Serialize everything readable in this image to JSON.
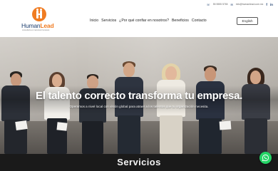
{
  "brand": {
    "name_part1": "Human",
    "name_part2": "Lead",
    "tagline": "consultoría en recursos humanos"
  },
  "contact": {
    "phone": "55 5555 5765",
    "email": "info@humanlead.com.mx",
    "social": [
      "f",
      "in"
    ]
  },
  "nav": {
    "items": [
      "Inicio",
      "Servicios",
      "¿Por qué confiar en nosotros?",
      "Beneficios",
      "Contacto"
    ]
  },
  "language_button": "English",
  "hero": {
    "title": "El talento correcto transforma tu empresa.",
    "subtitle": "Operamos a nivel local con visión global para atraer a los talentos que tu organización necesita."
  },
  "section": {
    "title": "Servicios"
  },
  "colors": {
    "brand_orange": "#f07c22",
    "brand_navy": "#1d3e6e",
    "band_dark": "#1a1a1a",
    "whatsapp_green": "#25d366"
  },
  "icons": [
    "phone-icon",
    "mail-icon",
    "facebook-icon",
    "linkedin-icon",
    "whatsapp-icon"
  ]
}
